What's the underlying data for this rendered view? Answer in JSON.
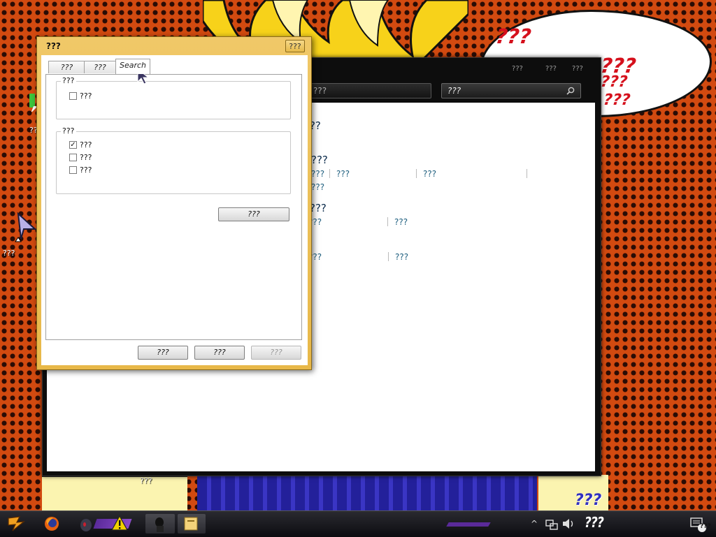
{
  "desktop": {
    "bubble_lines": [
      "???",
      "???",
      "???",
      "???"
    ],
    "icon_labels": [
      "???",
      "???",
      "???"
    ],
    "watermark": "???"
  },
  "control_panel": {
    "address_text": "???",
    "search_placeholder": "???",
    "window_buttons": [
      "???",
      "???",
      "???"
    ],
    "headings": [
      "???",
      "???",
      "???"
    ],
    "ease_links": [
      "???",
      "???",
      "???",
      "???"
    ],
    "options_links": [
      "???",
      "???"
    ],
    "font_links": [
      "???",
      "???"
    ]
  },
  "dialog": {
    "title": "???",
    "close_label": "???",
    "tabs": [
      "???",
      "???",
      "Search"
    ],
    "active_tab": "Search",
    "how_to_search": {
      "title": "???",
      "option": {
        "label": "???",
        "checked": false
      }
    },
    "non_indexed": {
      "title": "???",
      "options": [
        {
          "label": "???",
          "checked": true
        },
        {
          "label": "???",
          "checked": false
        },
        {
          "label": "???",
          "checked": false
        }
      ]
    },
    "restore_defaults": "???",
    "ok": "???",
    "cancel": "???",
    "apply": "???"
  },
  "taskbar": {
    "clock": "???",
    "notification_count": "???"
  },
  "colors": {
    "desktop_orange": "#d24a10",
    "dialog_frame": "#e8b848",
    "bubble_text": "#d5101c",
    "link": "#1f5f7f"
  }
}
